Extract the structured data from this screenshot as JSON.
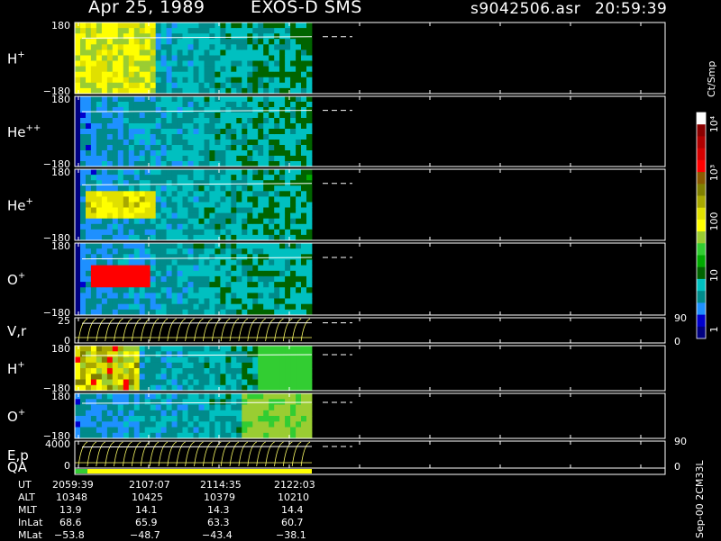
{
  "header": {
    "date": "Apr 25, 1989",
    "mission": "EXOS-D SMS",
    "file": "s9042506.asr",
    "time": "20:59:39"
  },
  "colorbar": {
    "unit": "Ct/Smp",
    "ticks": [
      "10⁴",
      "10³",
      "100",
      "10",
      "1"
    ],
    "colors": [
      "#ffffff",
      "#8b0000",
      "#b00000",
      "#d40000",
      "#ff0000",
      "#8b5a00",
      "#808000",
      "#a8a800",
      "#e0e000",
      "#ffff00",
      "#9acd32",
      "#32cd32",
      "#00aa00",
      "#006400",
      "#00c0c0",
      "#008b8b",
      "#1e90ff",
      "#0000cd",
      "#000080"
    ]
  },
  "side_note": "Sep-00 2CM33L",
  "chart_data": {
    "type": "heatmap",
    "x_times": [
      "2059:39",
      "2107:07",
      "2114:35",
      "2122:03"
    ],
    "panels": [
      {
        "label": "H",
        "sup": "+",
        "ymax": "180",
        "ymin": "−180"
      },
      {
        "label": "He",
        "sup": "++",
        "ymax": "180",
        "ymin": "−180"
      },
      {
        "label": "He",
        "sup": "+",
        "ymax": "180",
        "ymin": "−180"
      },
      {
        "label": "O",
        "sup": "+",
        "ymax": "180",
        "ymin": "−180"
      },
      {
        "label": "V,r",
        "sup": "",
        "ymax": "25",
        "ymin": "0",
        "rmax": "90",
        "rmin": "0"
      },
      {
        "label": "H",
        "sup": "+",
        "ymax": "180",
        "ymin": "−180"
      },
      {
        "label": "O",
        "sup": "+",
        "ymax": "180",
        "ymin": "−180"
      },
      {
        "label": "E,p",
        "sup": "",
        "ymax": "4000",
        "ymin": "0",
        "rmax": "90",
        "rmin": "0"
      }
    ],
    "qa_label": "QA",
    "ephemeris": [
      {
        "name": "UT",
        "values": [
          "2059:39",
          "2107:07",
          "2114:35",
          "2122:03"
        ]
      },
      {
        "name": "ALT",
        "values": [
          "10348",
          "10425",
          "10379",
          "10210"
        ]
      },
      {
        "name": "MLT",
        "values": [
          "13.9",
          "14.1",
          "14.3",
          "14.4"
        ]
      },
      {
        "name": "InLat",
        "values": [
          "68.6",
          "65.9",
          "63.3",
          "60.7"
        ]
      },
      {
        "name": "MLat",
        "values": [
          "−53.8",
          "−48.7",
          "−43.4",
          "−38.1"
        ]
      }
    ]
  }
}
